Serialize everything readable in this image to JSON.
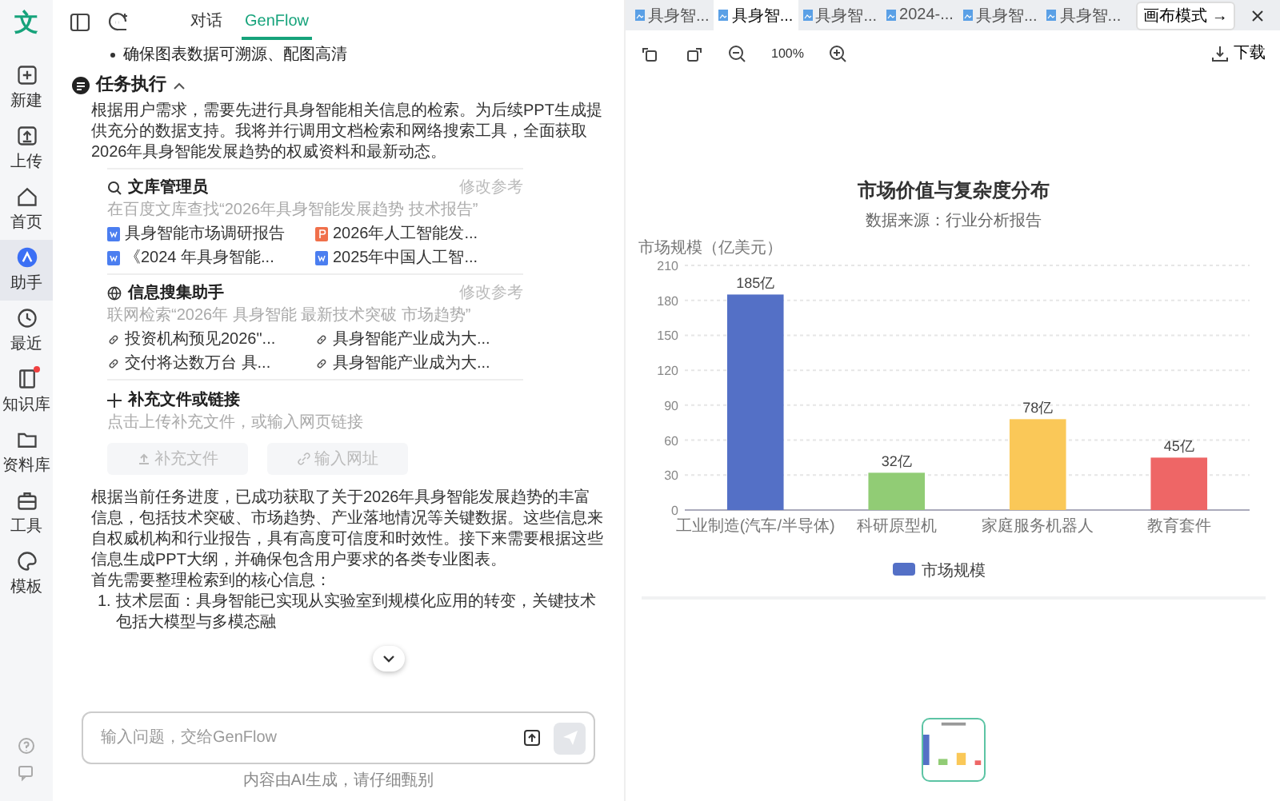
{
  "rail": {
    "items": [
      {
        "label": "新建",
        "kind": "plus",
        "selected": false,
        "dot": false
      },
      {
        "label": "上传",
        "kind": "upload",
        "selected": false,
        "dot": false
      },
      {
        "label": "首页",
        "kind": "home",
        "selected": false,
        "dot": false
      },
      {
        "label": "助手",
        "kind": "assistant",
        "selected": true,
        "dot": false
      },
      {
        "label": "最近",
        "kind": "clock",
        "selected": false,
        "dot": false
      },
      {
        "label": "知识库",
        "kind": "book",
        "selected": false,
        "dot": true
      },
      {
        "label": "资料库",
        "kind": "folder",
        "selected": false,
        "dot": false
      },
      {
        "label": "工具",
        "kind": "toolbox",
        "selected": false,
        "dot": false
      },
      {
        "label": "模板",
        "kind": "palette",
        "selected": false,
        "dot": false
      }
    ],
    "logo": "文"
  },
  "chat": {
    "tabs": [
      {
        "label": "对话",
        "selected": false
      },
      {
        "label": "GenFlow",
        "selected": true
      }
    ],
    "bullet": "确保图表数据可溯源、配图高清",
    "section": {
      "title": "任务执行",
      "expanded": true
    },
    "intro": "根据用户需求，需要先进行具身智能相关信息的检索。为后续PPT生成提供充分的数据支持。我将并行调用文档检索和网络搜索工具，全面获取2026年具身智能发展趋势的权威资料和最新动态。",
    "tools": [
      {
        "kind": "docs",
        "title": "文库管理员",
        "action": "修改参考",
        "query": "在百度文库查找“2026年具身智能发展趋势 技术报告”",
        "items": [
          {
            "kind": "word",
            "label": "具身智能市场调研报告"
          },
          {
            "kind": "ppt",
            "label": "2026年人工智能发..."
          },
          {
            "kind": "word",
            "label": "《2024 年具身智能..."
          },
          {
            "kind": "word",
            "label": "2025年中国人工智..."
          }
        ]
      },
      {
        "kind": "web",
        "title": "信息搜集助手",
        "action": "修改参考",
        "query": "联网检索“2026年 具身智能 最新技术突破 市场趋势”",
        "items": [
          {
            "kind": "link",
            "label": "投资机构预见2026\"..."
          },
          {
            "kind": "link",
            "label": "具身智能产业成为大..."
          },
          {
            "kind": "link",
            "label": "交付将达数万台 具..."
          },
          {
            "kind": "link",
            "label": "具身智能产业成为大..."
          }
        ]
      }
    ],
    "supplement": {
      "title": "补充文件或链接",
      "hint": "点击上传补充文件，或输入网页链接",
      "buttons": [
        {
          "kind": "upload",
          "label": "补充文件",
          "disabled": true
        },
        {
          "kind": "link",
          "label": "输入网址",
          "disabled": true
        }
      ]
    },
    "summary": "根据当前任务进度，已成功获取了关于2026年具身智能发展趋势的丰富信息，包括技术突破、市场趋势、产业落地情况等关键数据。这些信息来自权威机构和行业报告，具有高度可信度和时效性。接下来需要根据这些信息生成PPT大纲，并确保包含用户要求的各类专业图表。",
    "lead": "首先需要整理检索到的核心信息：",
    "list": [
      {
        "number": "1.",
        "text": "技术层面：具身智能已实现从实验室到规模化应用的转变，关键技术包括大模型与多模态融"
      }
    ],
    "input": {
      "placeholder": "输入问题，交给GenFlow"
    },
    "disclaimer": "内容由AI生成，请仔细甄别"
  },
  "viewer": {
    "tabs": [
      {
        "label": "具身智...",
        "selected": false
      },
      {
        "label": "具身智...",
        "selected": true
      },
      {
        "label": "具身智...",
        "selected": false
      },
      {
        "label": "2024-...",
        "selected": false
      },
      {
        "label": "具身智...",
        "selected": false
      },
      {
        "label": "具身智...",
        "selected": false
      }
    ],
    "canvas_button": "画布模式 →",
    "zoom": "100%",
    "download": "下载",
    "chart": {
      "subtitle": "数据来源：行业分析报告",
      "bars": [
        {
          "color": "#5470c6"
        },
        {
          "color": "#91cc75"
        },
        {
          "color": "#fac858"
        },
        {
          "color": "#ee6666"
        }
      ],
      "chart_data": {
        "type": "bar",
        "grid": true,
        "title": "市场价值与复杂度分布",
        "ylabel": "市场规模（亿美元）",
        "categories": [
          "工业制造(汽车/半导体)",
          "科研原型机",
          "家庭服务机器人",
          "教育套件"
        ],
        "series": [
          {
            "name": "市场规模",
            "values": [
              185,
              32,
              78,
              45
            ]
          }
        ],
        "ylim": [
          0,
          210
        ],
        "yticks": [
          0,
          30,
          60,
          90,
          120,
          150,
          180,
          210
        ],
        "value_labels": [
          "185亿",
          "32亿",
          "78亿",
          "45亿"
        ]
      }
    }
  }
}
